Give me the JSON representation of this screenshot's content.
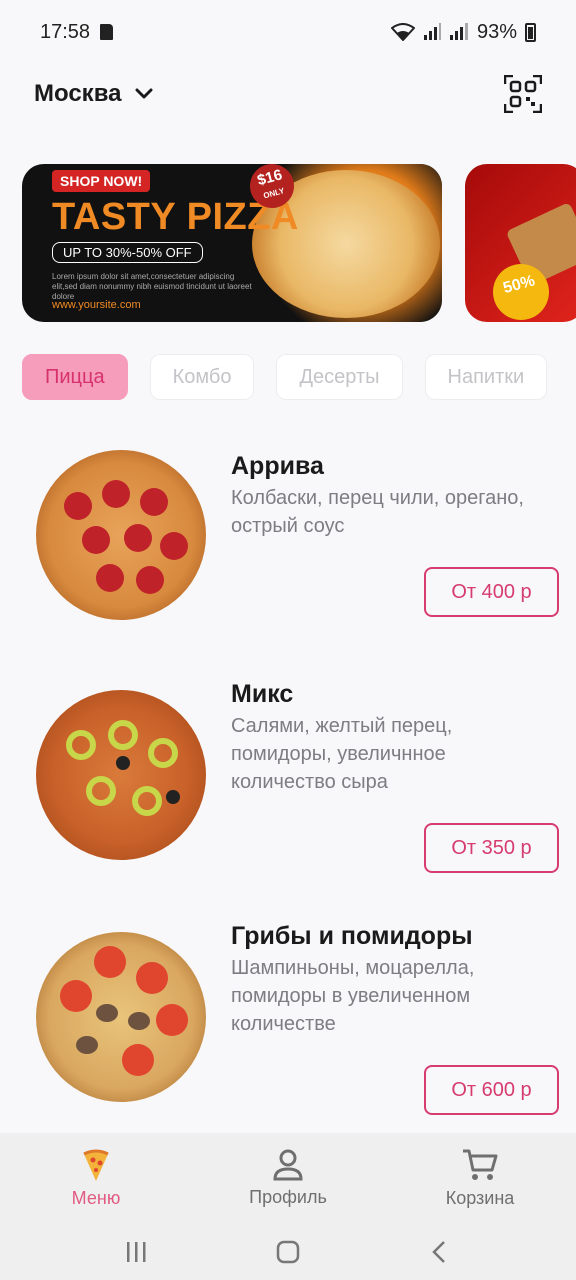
{
  "status_bar": {
    "time": "17:58",
    "battery": "93%"
  },
  "header": {
    "city": "Москва"
  },
  "banner": {
    "shop_now": "SHOP NOW!",
    "headline": "TASTY PIZZA",
    "offer": "UP TO 30%-50% OFF",
    "lorem": "Lorem ipsum dolor sit amet,consectetuer adipiscing elit,sed diam nonummy nibh euismod tincidunt ut laoreet dolore",
    "site": "www.yoursite.com",
    "price_tag": "$16",
    "price_tag_sub": "ONLY",
    "second_badge": "50%"
  },
  "categories": [
    {
      "label": "Пицца",
      "active": true
    },
    {
      "label": "Комбо",
      "active": false
    },
    {
      "label": "Десерты",
      "active": false
    },
    {
      "label": "Напитки",
      "active": false
    }
  ],
  "products": [
    {
      "title": "Аррива",
      "description": "Колбаски, перец чили, орегано, острый соус",
      "price": "От 400 р"
    },
    {
      "title": "Микс",
      "description": "Салями, желтый перец, помидоры, увеличнное количество сыра",
      "price": "От 350 р"
    },
    {
      "title": "Грибы и помидоры",
      "description": "Шампиньоны, моцарелла, помидоры в увеличенном количестве",
      "price": "От 600 р"
    }
  ],
  "bottom_nav": [
    {
      "label": "Меню",
      "icon": "pizza-icon",
      "active": true
    },
    {
      "label": "Профиль",
      "icon": "person-icon",
      "active": false
    },
    {
      "label": "Корзина",
      "icon": "cart-icon",
      "active": false
    }
  ],
  "colors": {
    "accent": "#d63c6e",
    "active_chip_bg": "#f59dbb",
    "nav_active": "#e05a82"
  }
}
